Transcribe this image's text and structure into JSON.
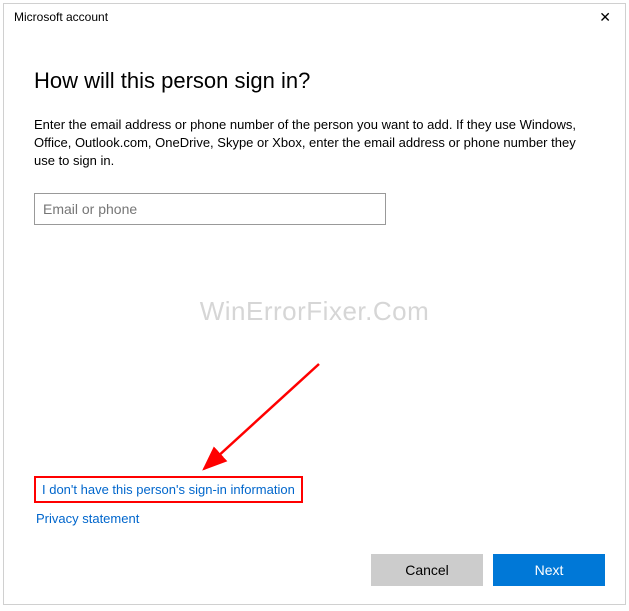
{
  "window": {
    "title": "Microsoft account"
  },
  "heading": "How will this person sign in?",
  "description": "Enter the email address or phone number of the person you want to add. If they use Windows, Office, Outlook.com, OneDrive, Skype or Xbox, enter the email address or phone number they use to sign in.",
  "input": {
    "placeholder": "Email or phone",
    "value": ""
  },
  "watermark": "WinErrorFixer.Com",
  "links": {
    "no_info": "I don't have this person's sign-in information",
    "privacy": "Privacy statement"
  },
  "buttons": {
    "cancel": "Cancel",
    "next": "Next"
  }
}
